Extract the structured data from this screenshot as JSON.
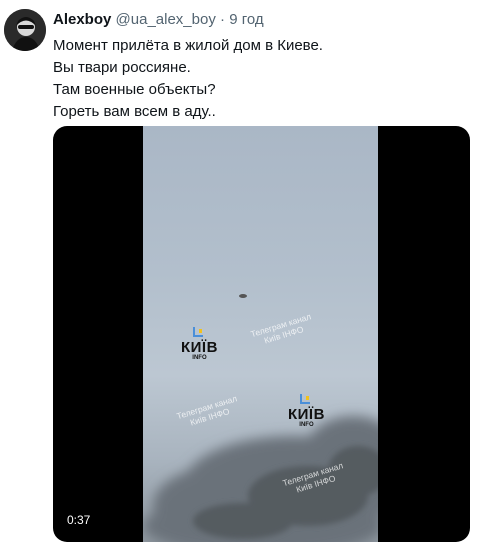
{
  "tweet": {
    "author_name": "Alexboy",
    "handle": "@ua_alex_boy",
    "separator": "·",
    "time": "9 год",
    "text_lines": [
      "Момент прилёта в жилой дом в Киеве.",
      "Вы твари россияне.",
      "Там военные объекты?",
      "Гореть вам всем в аду.."
    ]
  },
  "video": {
    "duration": "0:37",
    "watermarks": [
      {
        "line1": "Телеграм канал",
        "line2": "Київ ІНФО"
      },
      {
        "line1": "Телеграм канал",
        "line2": "Київ ІНФО"
      },
      {
        "line1": "Телеграм канал",
        "line2": "Київ ІНФО"
      }
    ],
    "logos": [
      {
        "word": "КИЇВ",
        "sub": "INFO"
      },
      {
        "word": "КИЇВ",
        "sub": "INFO"
      }
    ]
  },
  "colors": {
    "text": "#0f1419",
    "secondary": "#536471",
    "logo_blue": "#4a8fd9",
    "logo_yellow": "#f2c21b"
  }
}
